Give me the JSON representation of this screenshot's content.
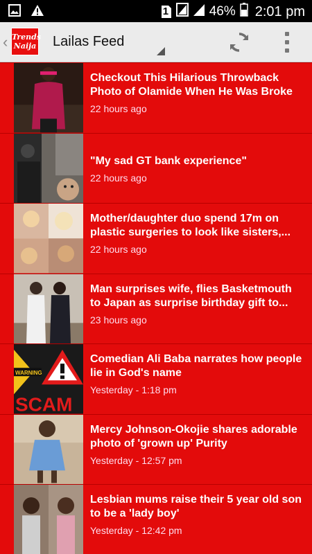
{
  "status_bar": {
    "sim_slot": "1",
    "battery_percent": "46%",
    "time": "2:01 pm"
  },
  "action_bar": {
    "logo_line1": "Trends",
    "logo_line2": "Naija",
    "title": "Lailas Feed",
    "icons": [
      "chevron-left-icon",
      "refresh-icon",
      "overflow-menu-icon"
    ]
  },
  "colors": {
    "feed_background": "#e30b0b",
    "action_bar": "#ebebeb",
    "status_bar": "#000000"
  },
  "feed": {
    "items": [
      {
        "title": "Checkout This Hilarious Throwback Photo of Olamide When He Was Broke",
        "time": "22 hours ago"
      },
      {
        "title": "\"My sad GT bank experience\"",
        "time": "22 hours ago"
      },
      {
        "title": "Mother/daughter duo spend 17m on plastic surgeries to look like sisters,...",
        "time": "22 hours ago"
      },
      {
        "title": "Man surprises wife, flies Basketmouth to Japan as surprise birthday gift to...",
        "time": "23 hours ago"
      },
      {
        "title": "Comedian Ali Baba narrates how people lie in God's name",
        "time": "Yesterday - 1:18 pm",
        "thumb_text_1": "WARNING",
        "thumb_text_2": "SCAM"
      },
      {
        "title": "Mercy Johnson-Okojie shares adorable photo of 'grown up' Purity",
        "time": "Yesterday - 12:57 pm"
      },
      {
        "title": "Lesbian mums raise their 5 year old son to be a 'lady boy'",
        "time": "Yesterday - 12:42 pm"
      }
    ]
  }
}
